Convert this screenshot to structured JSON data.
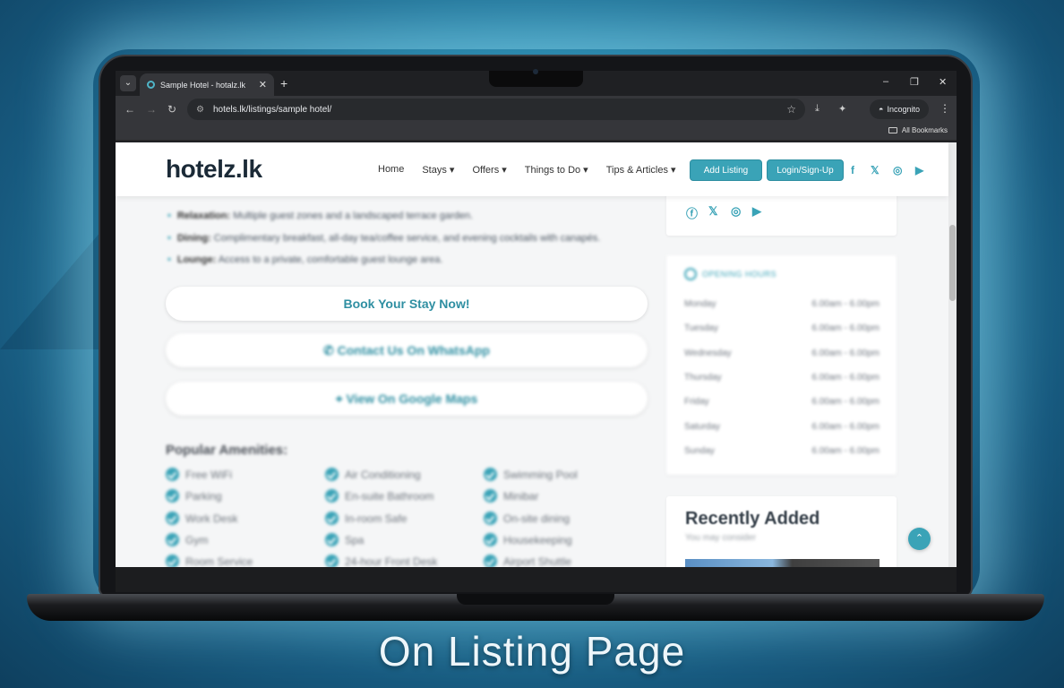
{
  "browser": {
    "tab_title": "Sample Hotel - hotalz.lk",
    "url": "hotels.lk/listings/sample hotel/",
    "incognito_label": "Incognito",
    "bookmarks_label": "All Bookmarks"
  },
  "site": {
    "logo": "hotelz.lk",
    "nav": [
      "Home",
      "Stays ▾",
      "Offers ▾",
      "Things to Do ▾",
      "Tips & Articles ▾"
    ],
    "add_listing": "Add Listing",
    "login": "Login/Sign-Up"
  },
  "features": [
    {
      "title": "Relaxation:",
      "text": " Multiple guest zones and a landscaped terrace garden."
    },
    {
      "title": "Dining:",
      "text": " Complimentary breakfast, all-day tea/coffee service, and evening cocktails with canapés."
    },
    {
      "title": "Lounge:",
      "text": " Access to a private, comfortable guest lounge area."
    }
  ],
  "actions": {
    "book": "Book Your Stay Now!",
    "whatsapp": "Contact Us On WhatsApp",
    "maps": "View On Google Maps"
  },
  "amenities_title": "Popular Amenities:",
  "amenities": [
    [
      "Free WiFi",
      "Air Conditioning",
      "Swimming Pool"
    ],
    [
      "Parking",
      "En-suite Bathroom",
      "Minibar"
    ],
    [
      "Work Desk",
      "In-room Safe",
      "On-site dining"
    ],
    [
      "Gym",
      "Spa",
      "Housekeeping"
    ],
    [
      "Room Service",
      "24-hour Front Desk",
      "Airport Shuttle"
    ]
  ],
  "opening_hours": {
    "title": "OPENING HOURS",
    "rows": [
      {
        "day": "Monday",
        "time": "6.00am - 6.00pm"
      },
      {
        "day": "Tuesday",
        "time": "6.00am - 6.00pm"
      },
      {
        "day": "Wednesday",
        "time": "6.00am - 6.00pm"
      },
      {
        "day": "Thursday",
        "time": "6.00am - 6.00pm"
      },
      {
        "day": "Friday",
        "time": "6.00am - 6.00pm"
      },
      {
        "day": "Saturday",
        "time": "6.00am - 6.00pm"
      },
      {
        "day": "Sunday",
        "time": "6.00am - 6.00pm"
      }
    ]
  },
  "recent": {
    "title": "Recently Added",
    "subtitle": "You may consider"
  },
  "caption": "On Listing Page",
  "colors": {
    "accent": "#3aa3b7",
    "background": "#1f6e94"
  }
}
